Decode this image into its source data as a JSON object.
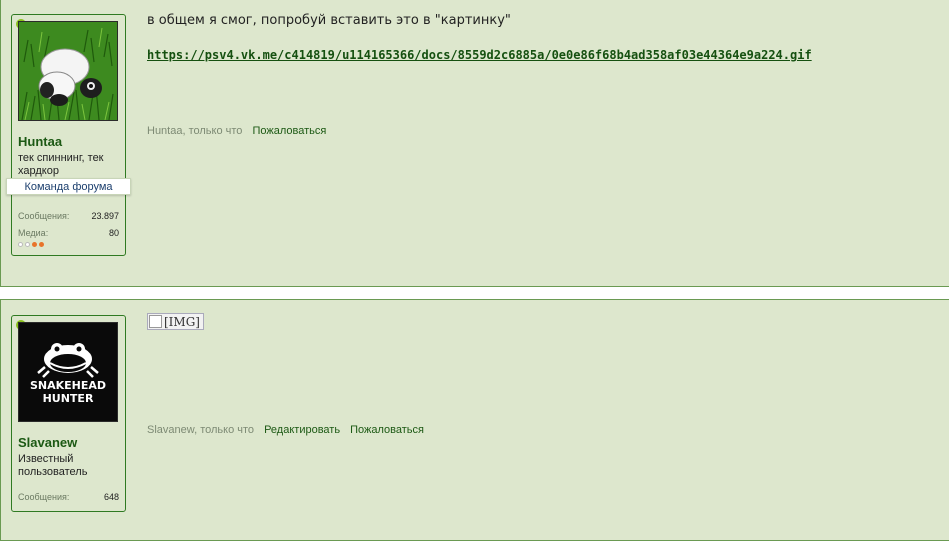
{
  "posts": [
    {
      "username": "Huntaa",
      "user_title": "тек спиннинг, тек хардкор",
      "staff_badge": "Команда форума",
      "stats": [
        {
          "label": "Сообщения:",
          "value": "23.897"
        },
        {
          "label": "Медиа:",
          "value": "80"
        }
      ],
      "message_text": "в общем я смог, попробуй вставить это в \"картинку\"",
      "message_link": "https://psv4.vk.me/c414819/u114165366/docs/8559d2c6885a/0e0e86f68b4ad358af03e44364e9a224.gif",
      "meta_author_time": "Huntaa, только что",
      "actions": [
        "Пожаловаться"
      ],
      "avatar_icon": "panda-on-grass-avatar",
      "reputation_colors": [
        "#ffffff",
        "#ffffff",
        "#e8742a",
        "#e8742a"
      ]
    },
    {
      "username": "Slavanew",
      "user_title": "Известный пользователь",
      "stats": [
        {
          "label": "Сообщения:",
          "value": "648"
        }
      ],
      "image_alt": "[IMG]",
      "meta_author_time": "Slavanew, только что",
      "actions": [
        "Редактировать",
        "Пожаловаться"
      ],
      "avatar_icon": "snakehead-hunter-frog-logo",
      "avatar_logo_lines": [
        "SNAKEHEAD",
        "HUNTER"
      ]
    }
  ],
  "colors": {
    "post_bg": "#dde7cd",
    "border": "#2f7a22",
    "link": "#1c5914",
    "online_dot": "#8ac11c"
  }
}
